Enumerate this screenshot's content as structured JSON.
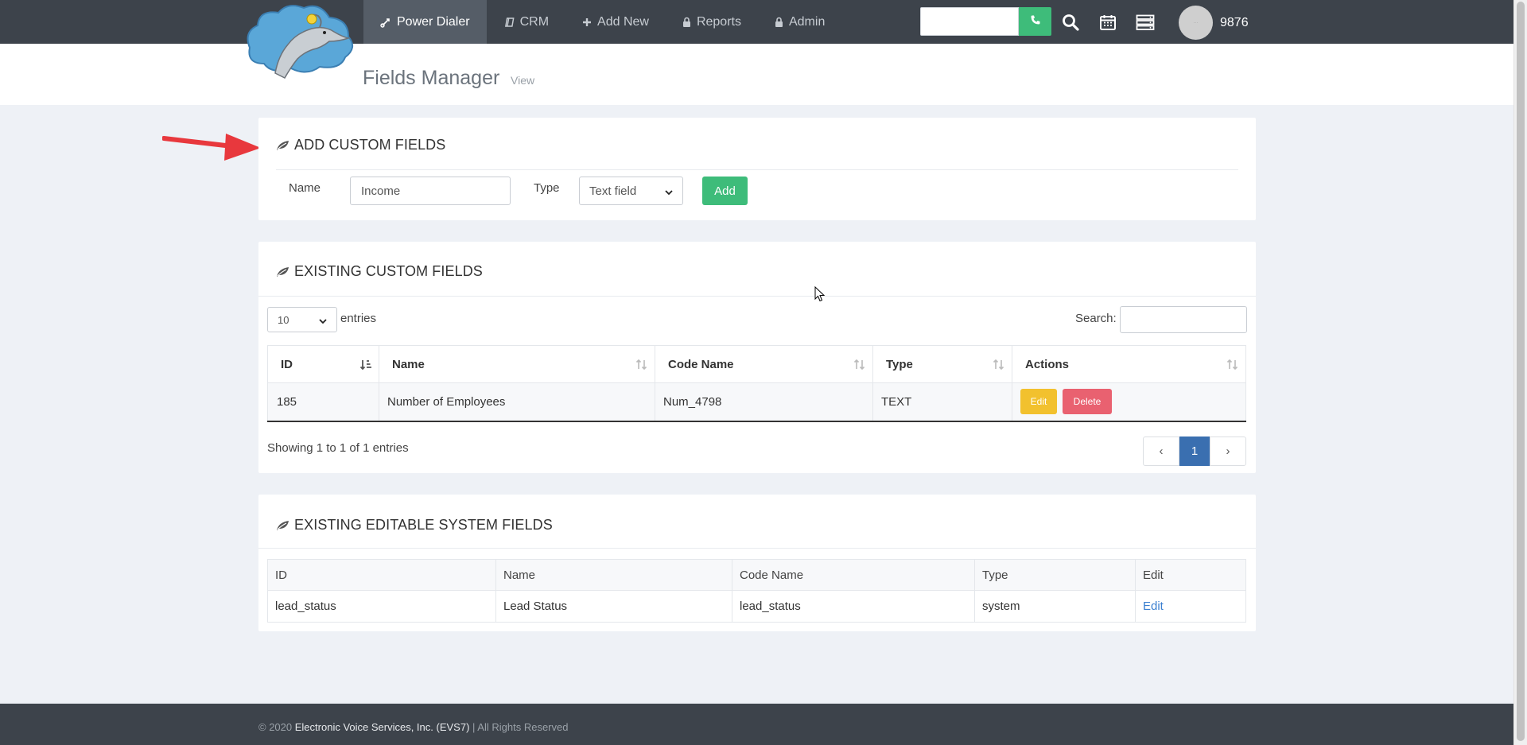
{
  "nav": {
    "items": [
      {
        "label": "Power Dialer",
        "icon": "power-dialer-icon",
        "active": true
      },
      {
        "label": "CRM",
        "icon": "book-icon",
        "active": false
      },
      {
        "label": "Add New",
        "icon": "plus-icon",
        "active": false
      },
      {
        "label": "Reports",
        "icon": "lock-icon",
        "active": false
      },
      {
        "label": "Admin",
        "icon": "lock-icon",
        "active": false
      }
    ],
    "dial_value": "",
    "user_number": "9876"
  },
  "header": {
    "title": "Fields Manager",
    "subtitle": "View"
  },
  "add_custom": {
    "title": "ADD CUSTOM FIELDS",
    "name_label": "Name",
    "name_value": "Income",
    "type_label": "Type",
    "type_value": "Text field",
    "add_label": "Add"
  },
  "existing_custom": {
    "title": "EXISTING CUSTOM FIELDS",
    "length_value": "10",
    "entries_label": "entries",
    "search_label": "Search:",
    "search_value": "",
    "columns": [
      "ID",
      "Name",
      "Code Name",
      "Type",
      "Actions"
    ],
    "rows": [
      {
        "id": "185",
        "name": "Number of Employees",
        "code": "Num_4798",
        "type": "TEXT"
      }
    ],
    "edit_label": "Edit",
    "delete_label": "Delete",
    "info": "Showing 1 to 1 of 1 entries",
    "pager": {
      "prev": "‹",
      "page": "1",
      "next": "›"
    }
  },
  "system_fields": {
    "title": "EXISTING EDITABLE SYSTEM FIELDS",
    "columns": [
      "ID",
      "Name",
      "Code Name",
      "Type",
      "Edit"
    ],
    "rows": [
      {
        "id": "lead_status",
        "name": "Lead Status",
        "code": "lead_status",
        "type": "system",
        "edit": "Edit"
      }
    ]
  },
  "footer": {
    "prefix": "© 2020",
    "company": "Electronic Voice Services, Inc. (EVS7)",
    "suffix": "| All Rights Reserved"
  },
  "colors": {
    "navbar": "#3d434b",
    "green": "#3ebc7a",
    "edit": "#f2c12e",
    "delete": "#e96170",
    "primary": "#3a6fb0"
  }
}
